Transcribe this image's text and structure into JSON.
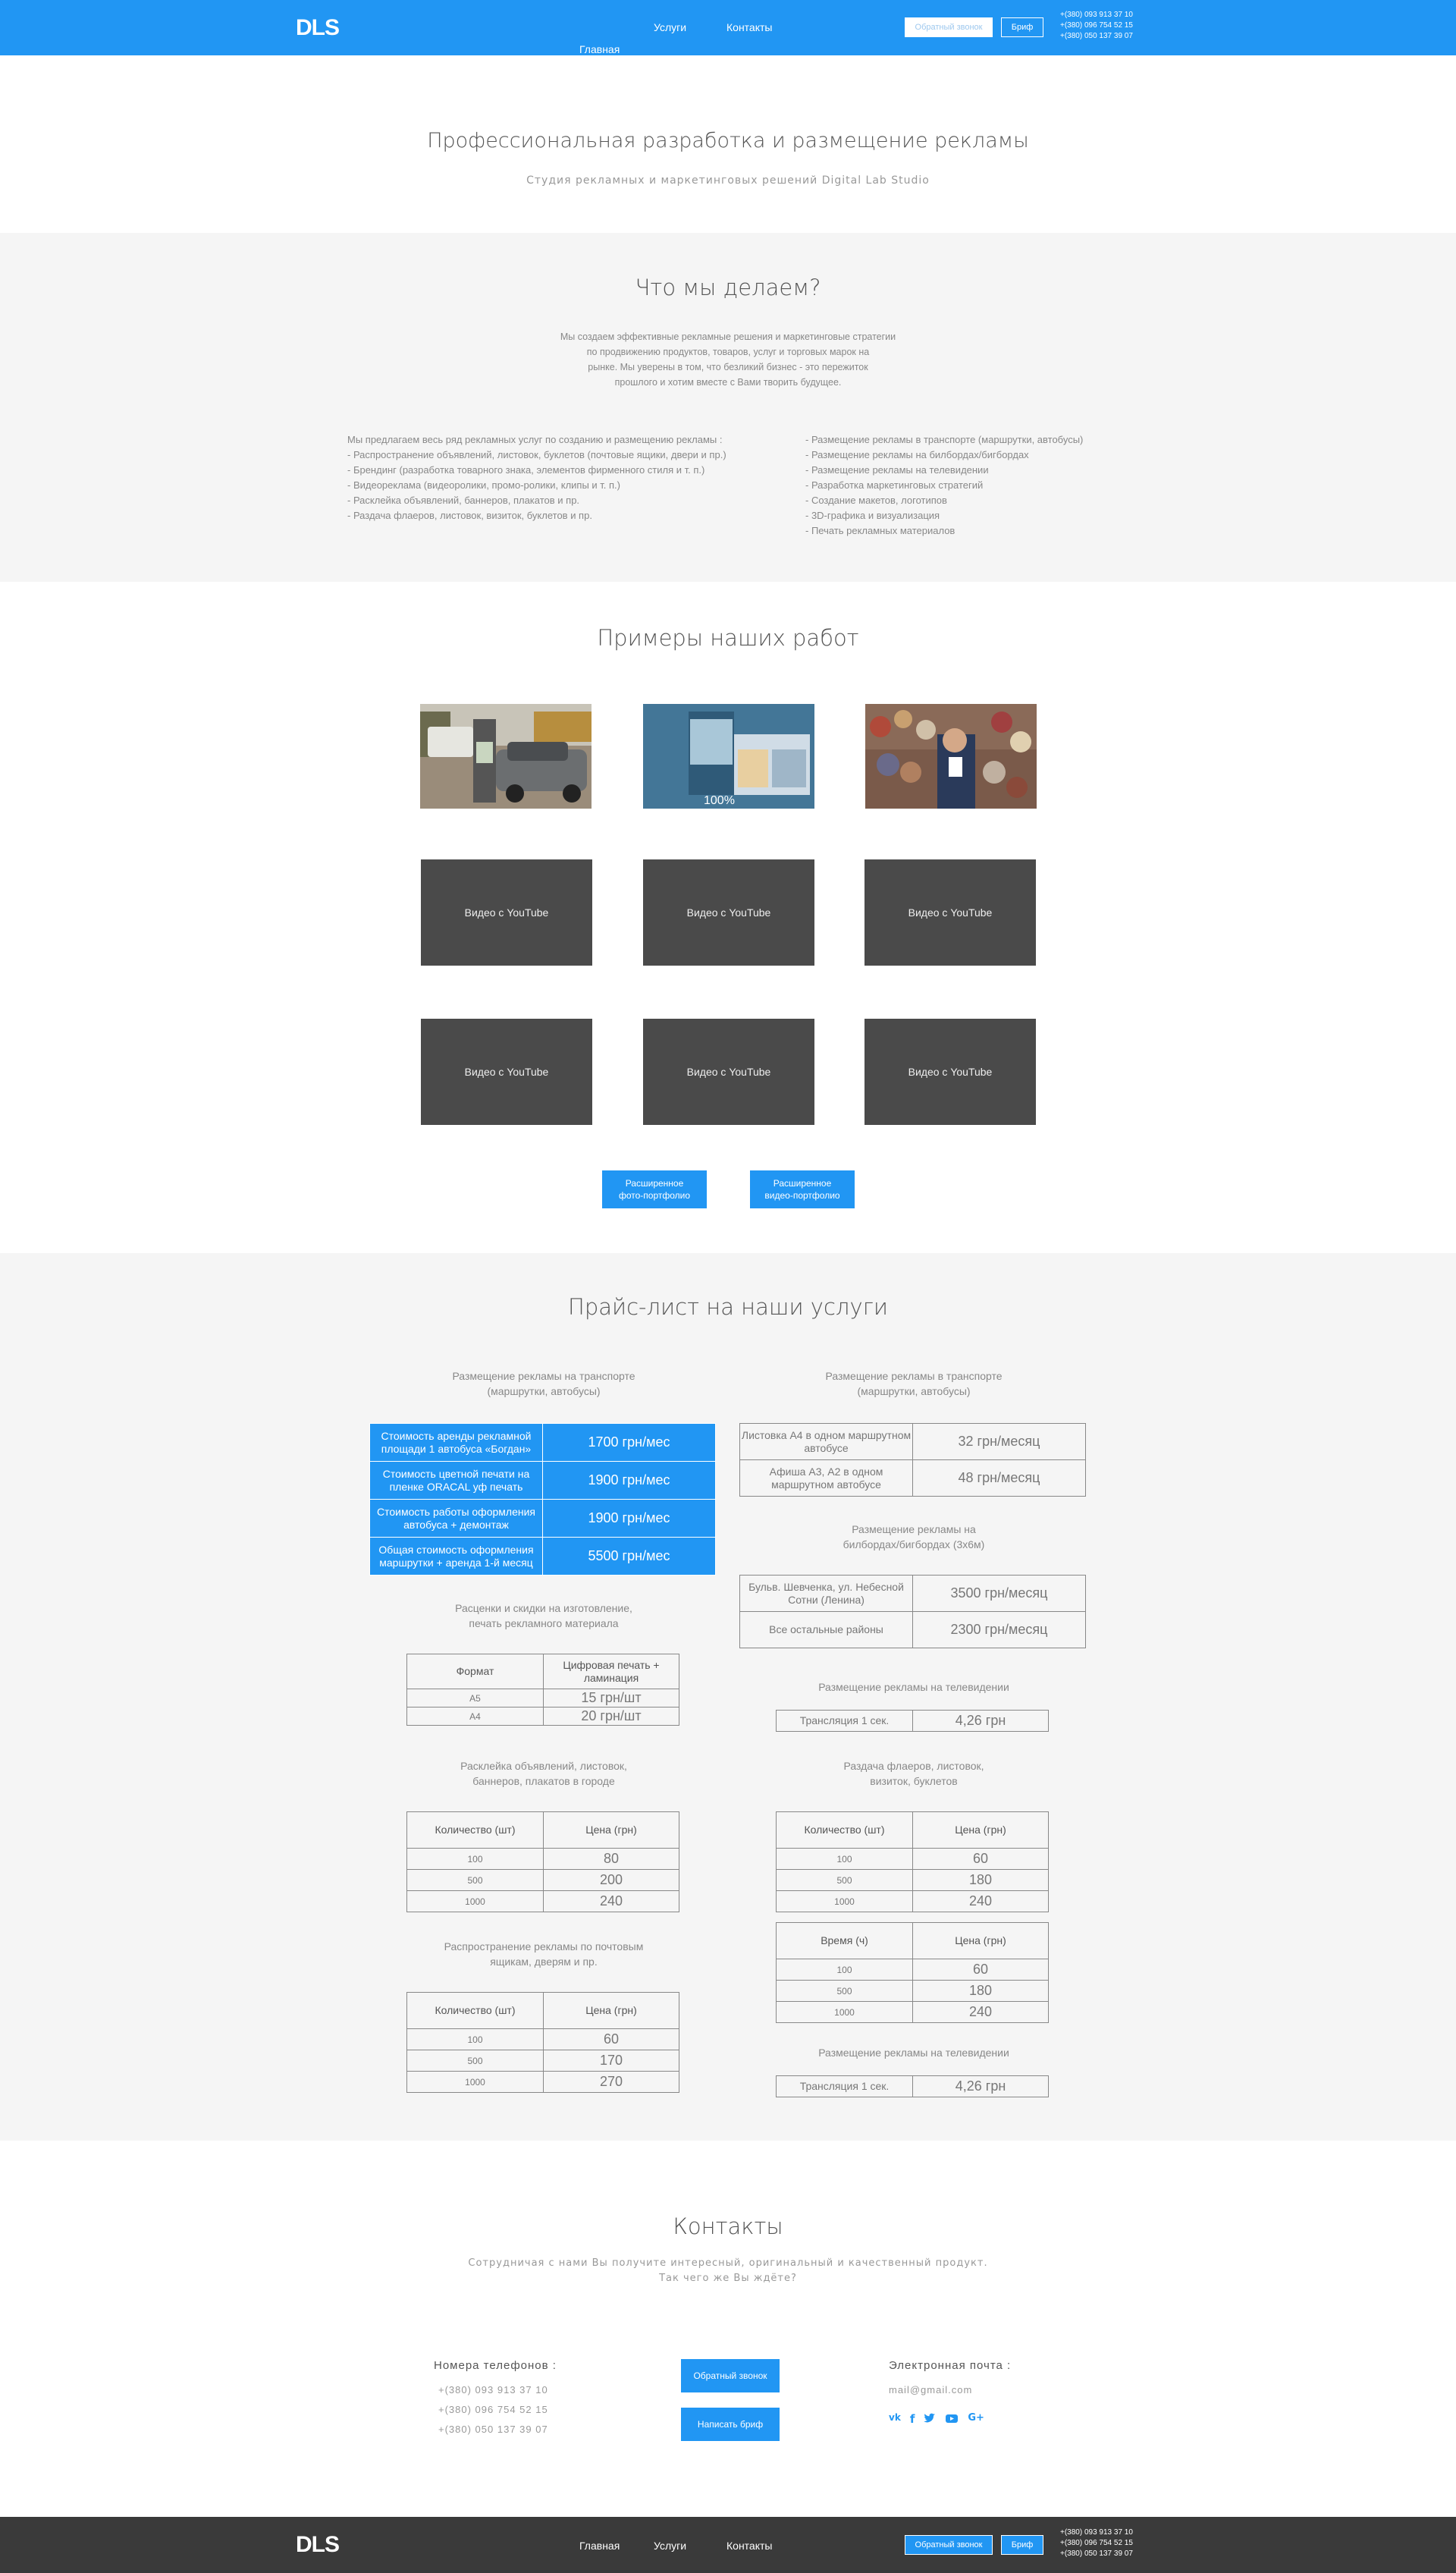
{
  "header": {
    "logo": "DLS",
    "nav": [
      "Главная",
      "Услуги",
      "Контакты"
    ],
    "callback": "Обратный звонок",
    "brief": "Бриф",
    "phones": [
      "+(380) 093 913 37 10",
      "+(380) 096 754 52 15",
      "+(380) 050 137 39 07"
    ]
  },
  "hero": {
    "title": "Профессиональная разработка и размещение рекламы",
    "subtitle": "Студия рекламных и маркетинговых решений Digital Lab Studio"
  },
  "about": {
    "title": "Что мы делаем?",
    "text": [
      "Мы создаем эффективные рекламные решения и маркетинговые стратегии",
      "по продвижению продуктов, товаров, услуг и торговых марок на",
      "рынке. Мы уверены в том, что безликий бизнес - это пережиток",
      "прошлого и хотим вместе с Вами творить будущее."
    ],
    "left": [
      "Мы предлагаем весь ряд рекламных услуг по созданию и размещению рекламы :",
      "- Распространение объявлений, листовок, буклетов (почтовые ящики, двери и пр.)",
      "- Брендинг (разработка товарного знака, элементов фирменного стиля и т. п.)",
      "- Видеореклама (видеоролики, промо-ролики, клипы и т. п.)",
      "- Расклейка объявлений, баннеров, плакатов и пр.",
      "- Раздача флаеров, листовок, визиток, буклетов и пр."
    ],
    "right": [
      "- Размещение рекламы в транспорте (маршрутки, автобусы)",
      "- Размещение рекламы на билбордах/бигбордах",
      "- Размещение рекламы на телевидении",
      "- Разработка маркетинговых стратегий",
      "- Создание макетов, логотипов",
      "- 3D-графика и визуализация",
      "- Печать рекламных материалов"
    ]
  },
  "works": {
    "title": "Примеры наших работ",
    "video_label": "Видео с YouTube",
    "btn_photo": [
      "Расширенное",
      "фото-портфолио"
    ],
    "btn_video": [
      "Расширенное",
      "видео-портфолио"
    ],
    "badge": "100%"
  },
  "prices": {
    "title": "Прайс-лист на наши услуги",
    "t1_title": [
      "Размещение рекламы на транспорте",
      "(маршрутки, автобусы)"
    ],
    "t1": [
      [
        "Стоимость аренды рекламной площади 1 автобуса «Богдан»",
        "1700 грн/мес"
      ],
      [
        "Стоимость цветной печати на пленке ORACAL уф печать",
        "1900 грн/мес"
      ],
      [
        "Стоимость работы оформления автобуса + демонтаж",
        "1900 грн/мес"
      ],
      [
        "Общая стоимость оформления маршрутки + аренда 1-й месяц",
        "5500 грн/мес"
      ]
    ],
    "t2_title": [
      "Размещение рекламы в транспорте",
      "(маршрутки, автобусы)"
    ],
    "t2": [
      [
        "Листовка А4 в одном маршрутном автобусе",
        "32 грн/месяц"
      ],
      [
        "Афиша А3, А2 в одном маршрутном автобусе",
        "48 грн/месяц"
      ]
    ],
    "t3_title": [
      "Размещение рекламы на",
      "билбордах/бигбордах (3х6м)"
    ],
    "t3": [
      [
        "Бульв. Шевченка, ул. Небесной Сотни (Ленина)",
        "3500 грн/месяц"
      ],
      [
        "Все остальные районы",
        "2300 грн/месяц"
      ]
    ],
    "t4_title": [
      "Расценки и скидки на изготовление,",
      "печать рекламного материала"
    ],
    "t4_head": [
      "Формат",
      "Цифровая печать + ламинация"
    ],
    "t4": [
      [
        "А5",
        "15 грн/шт"
      ],
      [
        "А4",
        "20 грн/шт"
      ]
    ],
    "tv_title": "Размещение рекламы на телевидении",
    "tv": [
      "Трансляция 1 сек.",
      "4,26 грн"
    ],
    "t5_title": [
      "Расклейка объявлений, листовок,",
      "баннеров, плакатов в городе"
    ],
    "qty_head": [
      "Количество (шт)",
      "Цена (грн)"
    ],
    "t5": [
      [
        "100",
        "80"
      ],
      [
        "500",
        "200"
      ],
      [
        "1000",
        "240"
      ]
    ],
    "t6_title": [
      "Раздача флаеров, листовок,",
      "визиток, буклетов"
    ],
    "t6": [
      [
        "100",
        "60"
      ],
      [
        "500",
        "180"
      ],
      [
        "1000",
        "240"
      ]
    ],
    "t7_head": [
      "Время (ч)",
      "Цена (грн)"
    ],
    "t7": [
      [
        "100",
        "60"
      ],
      [
        "500",
        "180"
      ],
      [
        "1000",
        "240"
      ]
    ],
    "t8_title": [
      "Распространение рекламы по почтовым",
      "ящикам, дверям и пр."
    ],
    "t8": [
      [
        "100",
        "60"
      ],
      [
        "500",
        "170"
      ],
      [
        "1000",
        "270"
      ]
    ]
  },
  "contacts": {
    "title": "Контакты",
    "text": [
      "Сотрудничая с нами Вы получите интересный, оригинальный и качественный продукт.",
      "Так чего же Вы ждёте?"
    ],
    "phones_title": "Номера телефонов :",
    "phones": [
      "+(380) 093 913 37 10",
      "+(380) 096 754 52 15",
      "+(380) 050 137 39 07"
    ],
    "callback": "Обратный звонок",
    "brief": "Написать бриф",
    "email_title": "Электронная почта :",
    "email": "mail@gmail.com",
    "social": [
      "vk-icon",
      "facebook-icon",
      "twitter-icon",
      "youtube-icon",
      "google-plus-icon"
    ]
  },
  "colors": {
    "accent": "#2196f3",
    "footer": "#3a3a3a",
    "video": "#4a4a4a"
  }
}
